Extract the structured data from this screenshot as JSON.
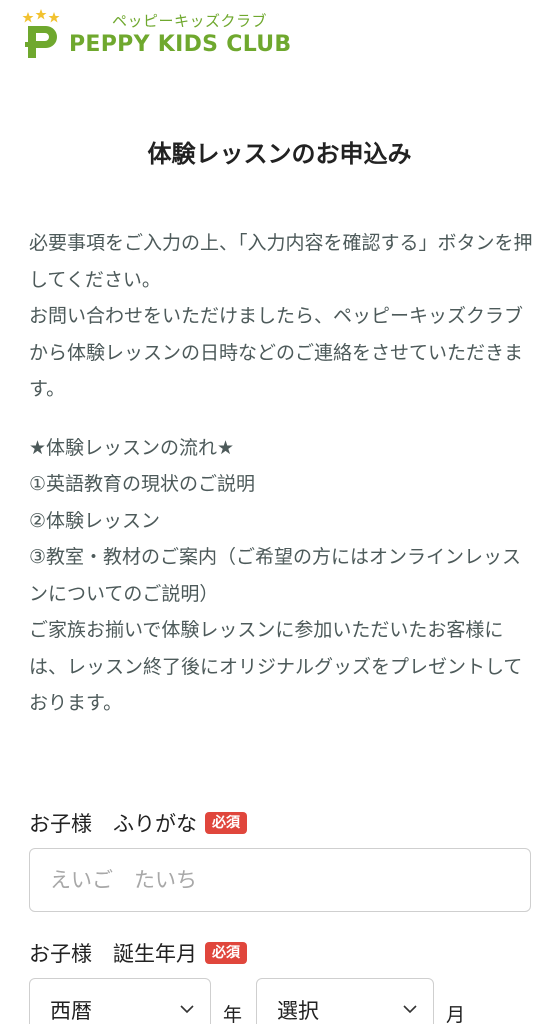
{
  "header": {
    "logo_kana": "ペッピーキッズクラブ",
    "logo_name": "PEPPY KIDS CLUB",
    "brand_color": "#6fa82e",
    "star_color": "#f2c230"
  },
  "page": {
    "title": "体験レッスンのお申込み"
  },
  "intro": {
    "paragraph1": "必要事項をご入力の上、「入力内容を確認する」ボタンを押してください。",
    "paragraph2": "お問い合わせをいただけましたら、ペッピーキッズクラブから体験レッスンの日時などのご連絡をさせていただきます。",
    "flow_heading": "★体験レッスンの流れ★",
    "flow_1": "①英語教育の現状のご説明",
    "flow_2": "②体験レッスン",
    "flow_3": "③教室・教材のご案内（ご希望の方にはオンラインレッスンについてのご説明）",
    "gift_note": "ご家族お揃いで体験レッスンに参加いただいたお客様には、レッスン終了後にオリジナルグッズをプレゼントしております。"
  },
  "form": {
    "furigana_label": "お子様　ふりがな",
    "furigana_required": "必須",
    "furigana_placeholder": "えいご　たいち",
    "furigana_value": "",
    "birthdate_label": "お子様　誕生年月",
    "birthdate_required": "必須",
    "era_select_value": "西暦",
    "year_unit": "年",
    "month_select_value": "選択",
    "month_unit": "月",
    "required_color": "#e0463c"
  }
}
